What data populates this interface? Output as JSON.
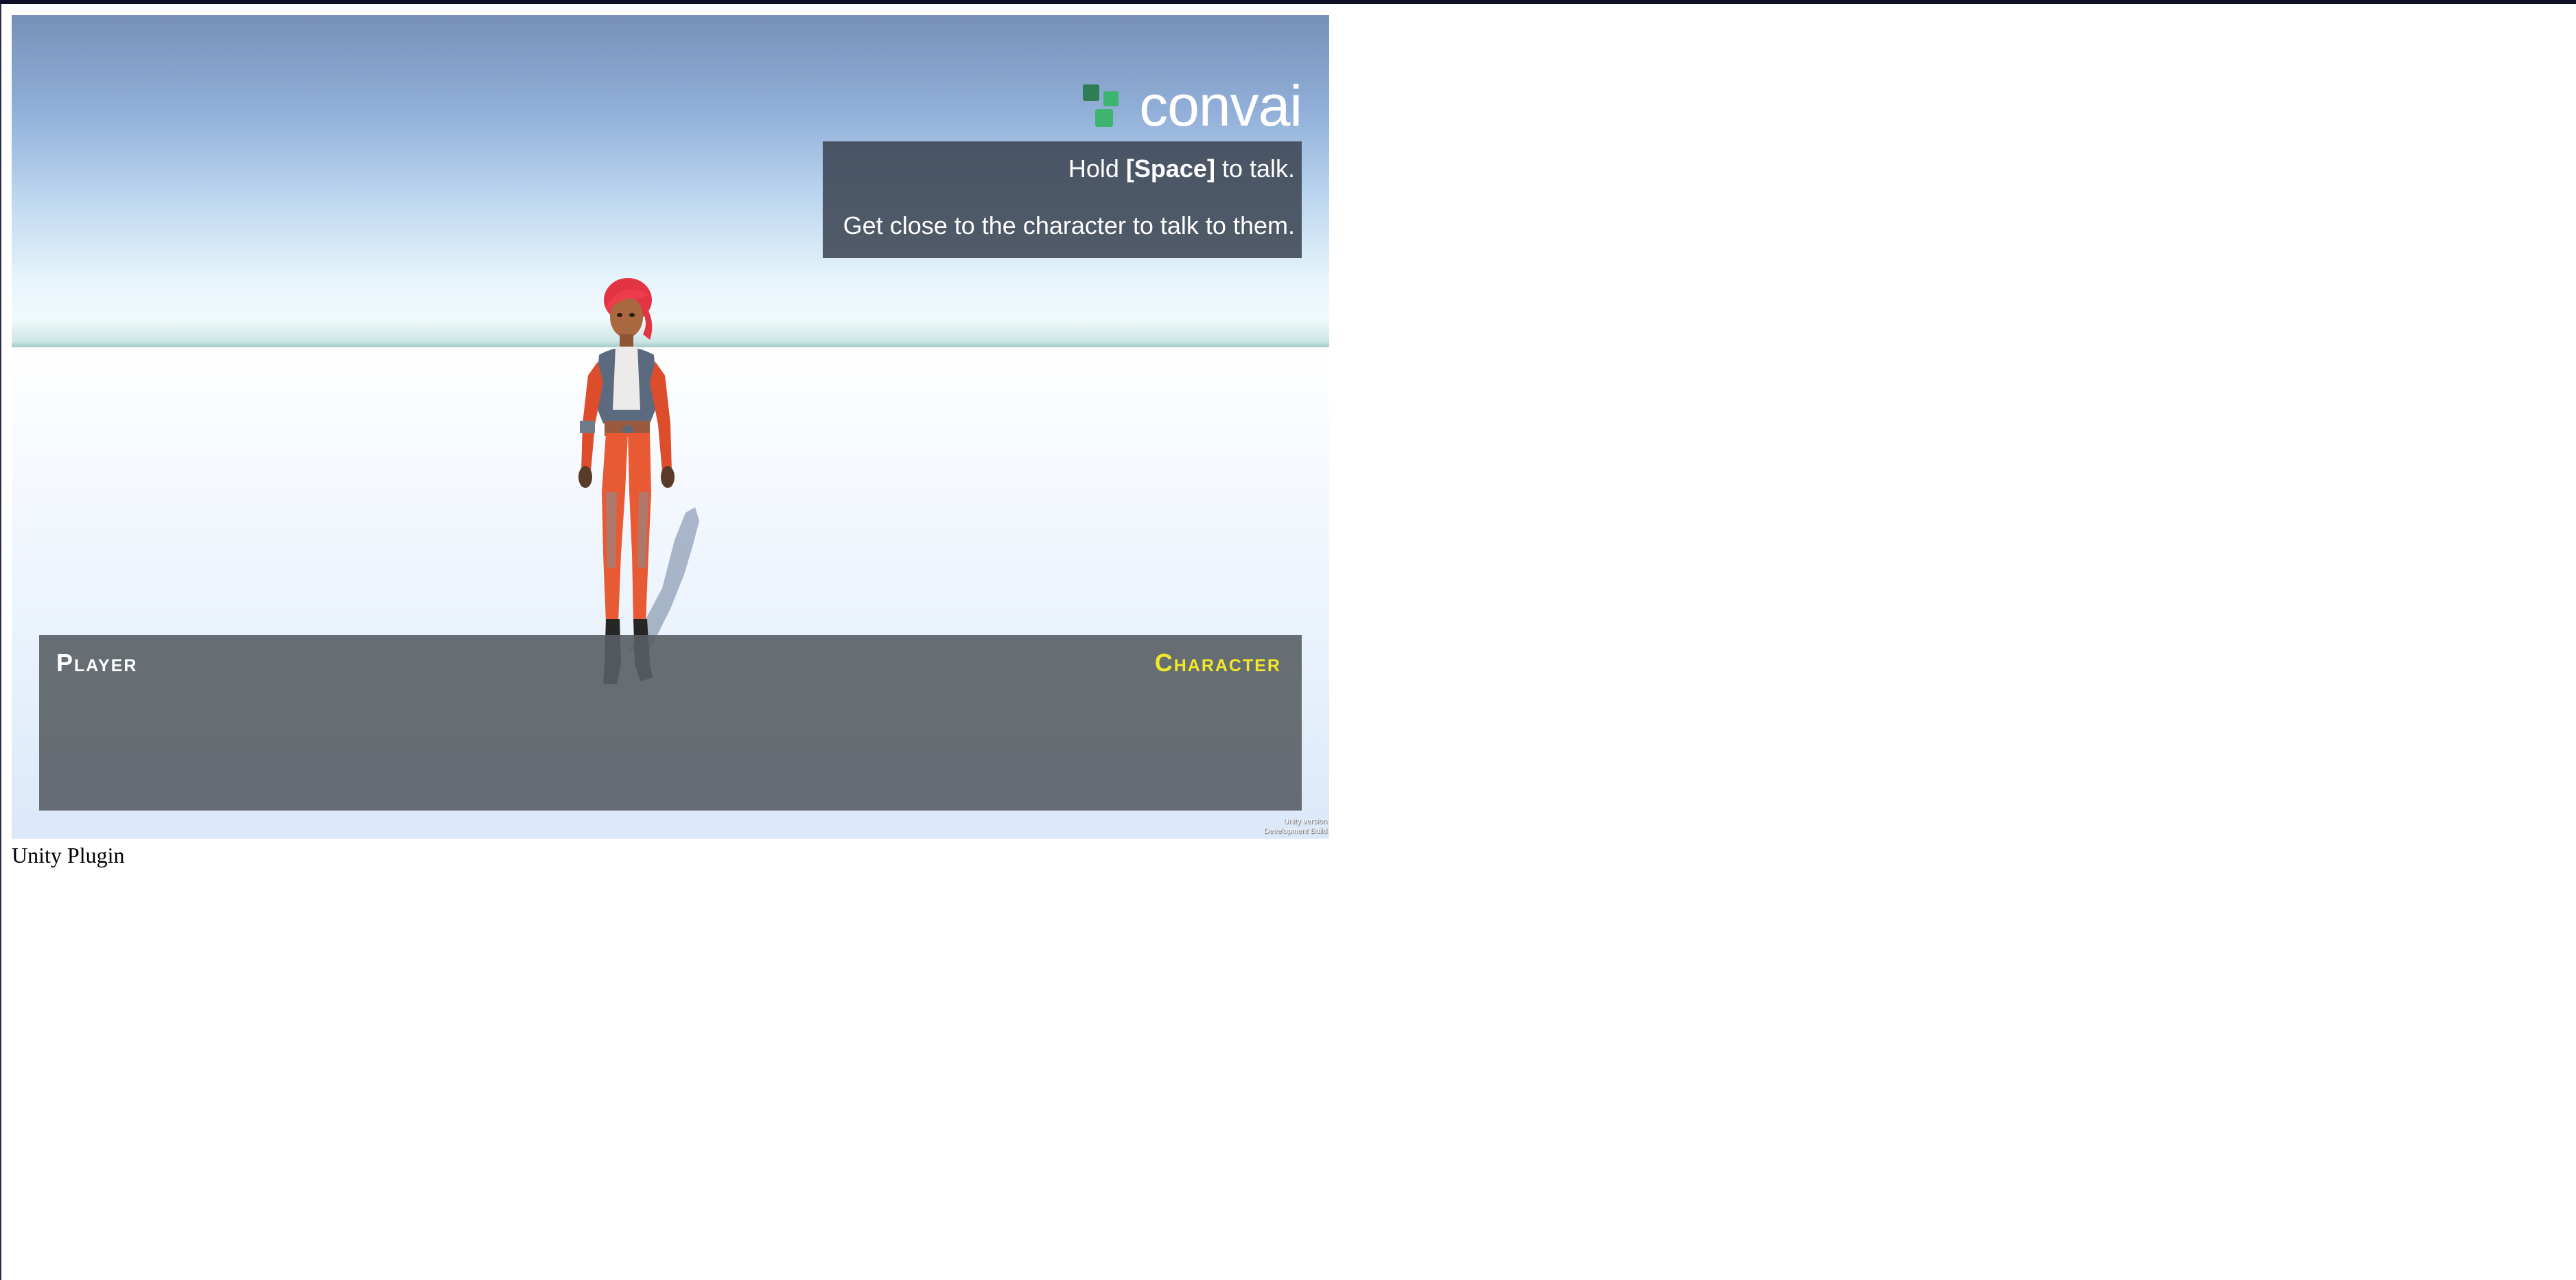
{
  "brand": {
    "logo_text": "convai",
    "logo_icon": "convai-logo-icon",
    "accent_color": "#3db56f"
  },
  "instructions": {
    "line1_prefix": "Hold ",
    "line1_key": "[Space]",
    "line1_suffix": " to talk.",
    "line2": "Get close to the character to talk to them."
  },
  "dialogue": {
    "player_label": "Player",
    "character_label": "Character",
    "character_label_color": "#f2e82a"
  },
  "build_info": {
    "line1": "Unity version",
    "line2": "Development Build"
  },
  "page_caption": "Unity Plugin"
}
